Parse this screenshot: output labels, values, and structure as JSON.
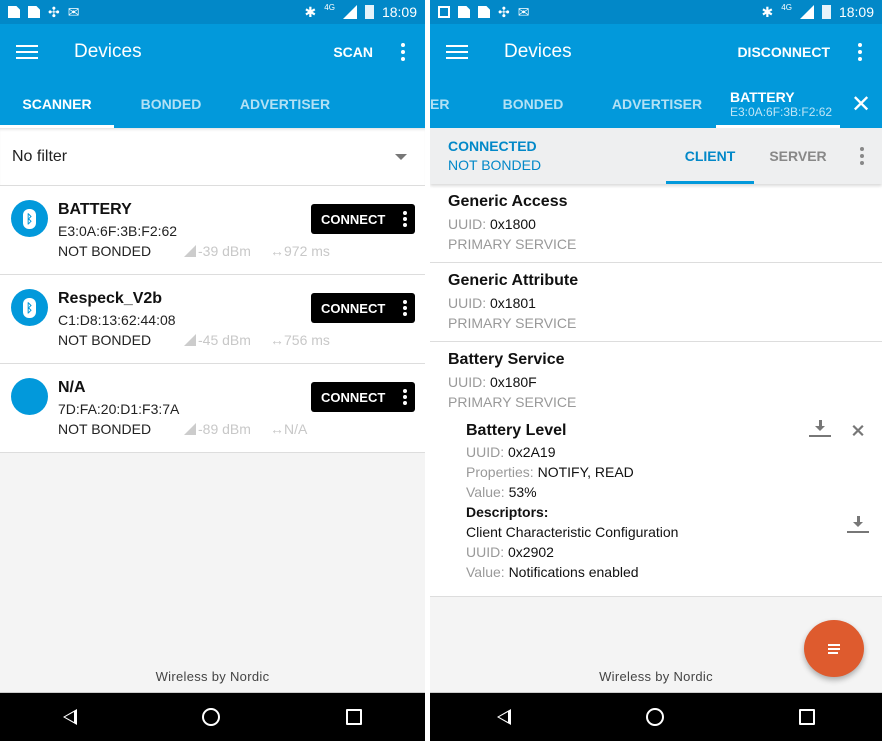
{
  "status_bar": {
    "time": "18:09",
    "network": "4G"
  },
  "left": {
    "app_title": "Devices",
    "action": "SCAN",
    "tabs": [
      {
        "label": "SCANNER",
        "active": true
      },
      {
        "label": "BONDED",
        "active": false
      },
      {
        "label": "ADVERTISER",
        "active": false
      }
    ],
    "filter": {
      "value": "No filter"
    },
    "devices": [
      {
        "icon": "bluetooth-icon",
        "name": "BATTERY",
        "address": "E3:0A:6F:3B:F2:62",
        "bond": "NOT BONDED",
        "rssi": "-39 dBm",
        "interval": "972 ms",
        "button": "CONNECT"
      },
      {
        "icon": "bluetooth-icon",
        "name": "Respeck_V2b",
        "address": "C1:D8:13:62:44:08",
        "bond": "NOT BONDED",
        "rssi": "-45 dBm",
        "interval": "756 ms",
        "button": "CONNECT"
      },
      {
        "icon": "apple-icon",
        "name": "N/A",
        "address": "7D:FA:20:D1:F3:7A",
        "bond": "NOT BONDED",
        "rssi": "-89 dBm",
        "interval": "N/A",
        "button": "CONNECT"
      }
    ],
    "footer": "Wireless by Nordic"
  },
  "right": {
    "app_title": "Devices",
    "action": "DISCONNECT",
    "tabs": [
      {
        "label": "ER",
        "active": false
      },
      {
        "label": "BONDED",
        "active": false
      },
      {
        "label": "ADVERTISER",
        "active": false
      },
      {
        "label": "BATTERY",
        "sub": "E3:0A:6F:3B:F2:62",
        "active": true
      }
    ],
    "connection": {
      "state": "CONNECTED",
      "bond": "NOT BONDED"
    },
    "sub_tabs": [
      {
        "label": "CLIENT",
        "active": true
      },
      {
        "label": "SERVER",
        "active": false
      }
    ],
    "labels": {
      "uuid": "UUID:",
      "properties": "Properties:",
      "value": "Value:",
      "descriptors": "Descriptors:"
    },
    "services": [
      {
        "name": "Generic Access",
        "uuid": "0x1800",
        "type": "PRIMARY SERVICE"
      },
      {
        "name": "Generic Attribute",
        "uuid": "0x1801",
        "type": "PRIMARY SERVICE"
      },
      {
        "name": "Battery Service",
        "uuid": "0x180F",
        "type": "PRIMARY SERVICE",
        "characteristic": {
          "name": "Battery Level",
          "uuid": "0x2A19",
          "properties": "NOTIFY, READ",
          "value": "53%",
          "descriptor": {
            "name": "Client Characteristic Configuration",
            "uuid": "0x2902",
            "value": "Notifications enabled"
          }
        }
      }
    ],
    "footer": "Wireless by Nordic",
    "fab_color": "#de5b2e"
  },
  "colors": {
    "primary": "#0299db",
    "status_bar": "#0288c8"
  }
}
